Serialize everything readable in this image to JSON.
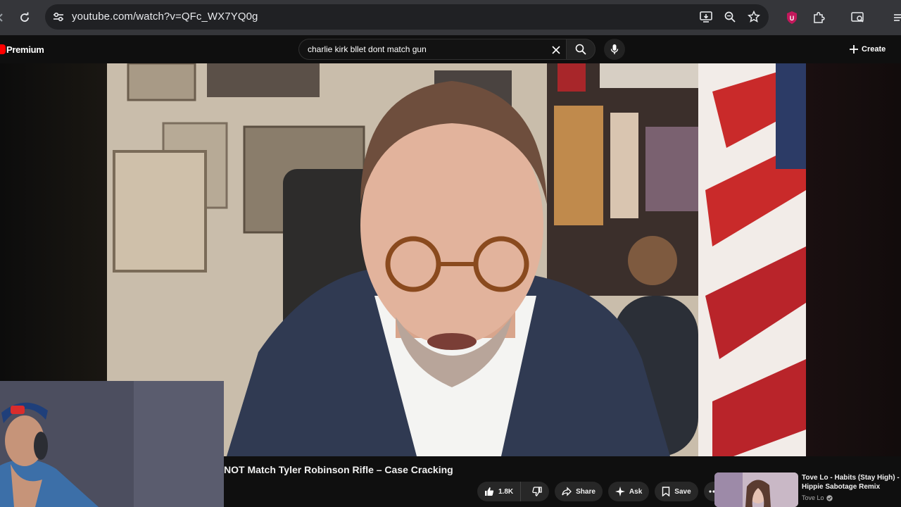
{
  "browser": {
    "url": "youtube.com/watch?v=QFc_WX7YQ0g",
    "extension_badge": "U"
  },
  "masthead": {
    "logo_text": "Premium",
    "search_query": "charlie kirk bllet dont match gun",
    "create_label": "Create"
  },
  "video": {
    "title": "NOT Match Tyler Robinson Rifle – Case Cracking",
    "like_count": "1.8K",
    "share_label": "Share",
    "ask_label": "Ask",
    "save_label": "Save"
  },
  "recommendation": {
    "title": "Tove Lo - Habits (Stay High) - Hippie Sabotage Remix",
    "channel": "Tove Lo"
  },
  "colors": {
    "youtube_red": "#ff0000",
    "chrome_bar": "#35363a",
    "page_bg": "#0f0f0f"
  }
}
